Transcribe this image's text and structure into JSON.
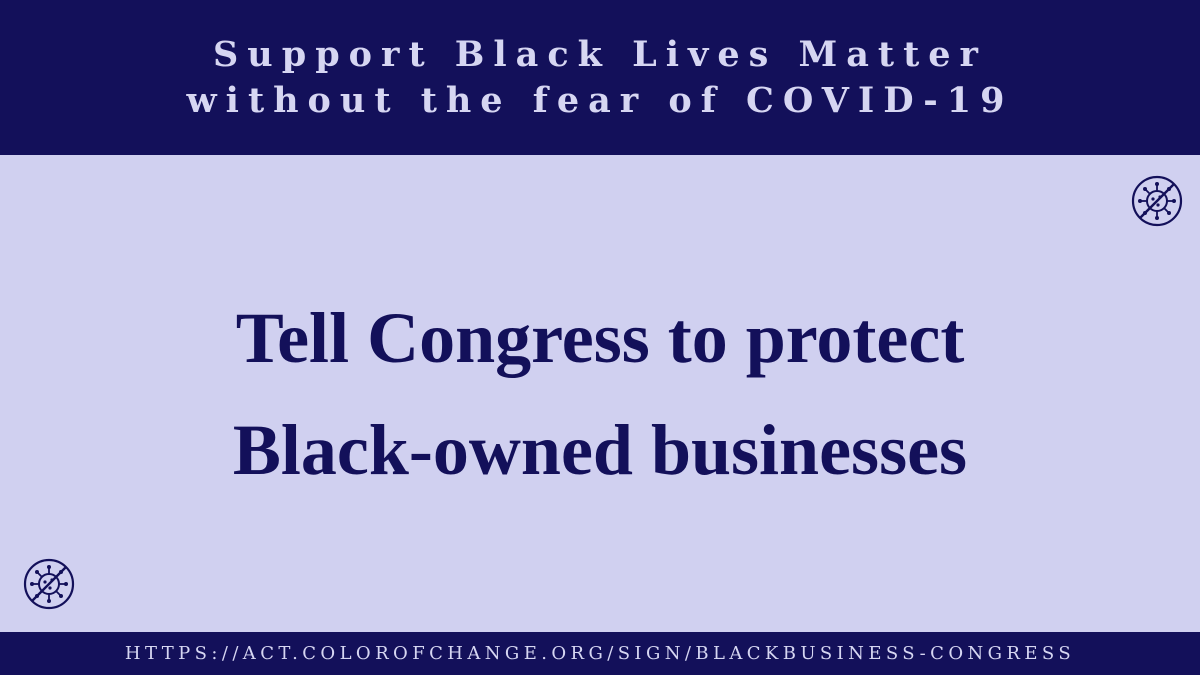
{
  "banner": {
    "line1": "Support Black Lives Matter",
    "line2": "without the fear of COVID-19"
  },
  "headline": {
    "line1": "Tell Congress to protect",
    "line2": "Black-owned businesses"
  },
  "footer": {
    "url": "HTTPS://ACT.COLOROFCHANGE.ORG/SIGN/BLACKBUSINESS-CONGRESS"
  },
  "icons": [
    "no-virus-icon",
    "no-virus-icon"
  ],
  "colors": {
    "navy": "#13105a",
    "lavender": "#d0d0f0",
    "banner_text": "#d6d6f2"
  }
}
